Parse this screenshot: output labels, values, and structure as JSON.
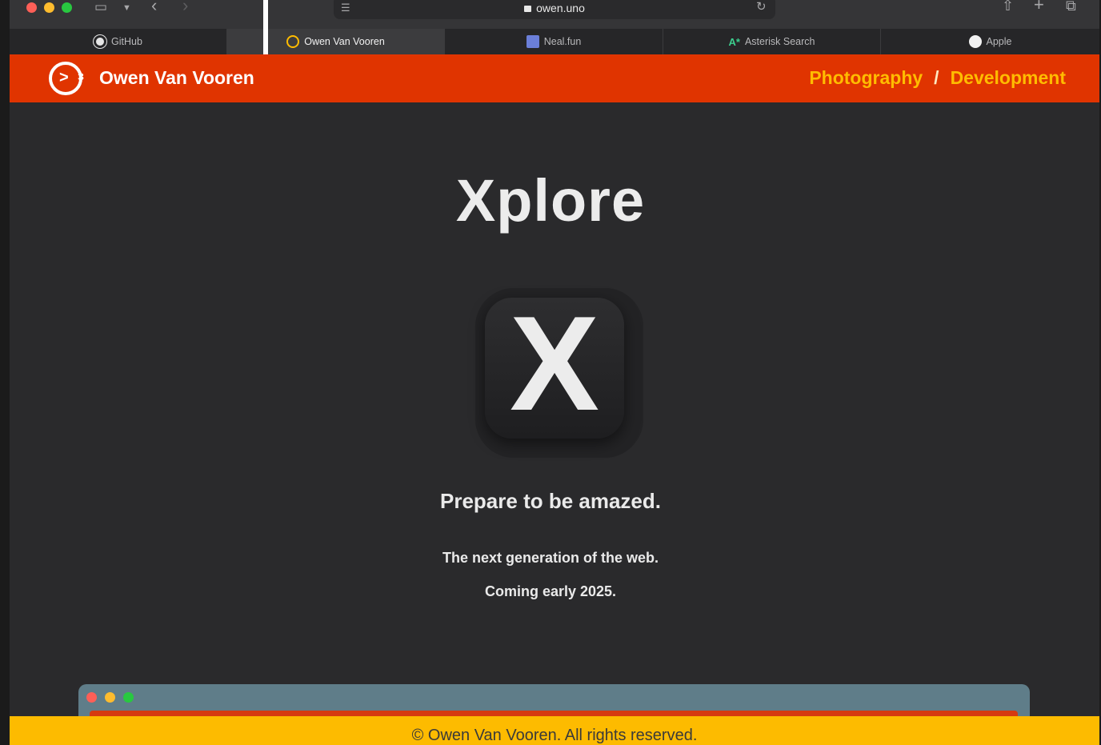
{
  "browser": {
    "url": "owen.uno",
    "tabs": [
      {
        "label": "GitHub",
        "active": false
      },
      {
        "label": "Owen Van Vooren",
        "active": true
      },
      {
        "label": "Neal.fun",
        "active": false
      },
      {
        "label": "Asterisk Search",
        "active": false
      },
      {
        "label": "Apple",
        "active": false
      }
    ],
    "close_tab_glyph": "×"
  },
  "site": {
    "name": "Owen Van Vooren",
    "nav": {
      "photography": "Photography",
      "separator": "/",
      "development": "Development"
    }
  },
  "hero": {
    "title": "Xplore",
    "icon_letter": "X",
    "tagline": "Prepare to be amazed.",
    "sub1": "The next generation of the web.",
    "sub2": "Coming early 2025."
  },
  "footer": {
    "text": "© Owen Van Vooren. All rights reserved."
  },
  "colors": {
    "header_bg": "#e03400",
    "nav_accent": "#ffbc00",
    "footer_bg": "#fdbb00",
    "page_bg": "#2a2a2c"
  }
}
